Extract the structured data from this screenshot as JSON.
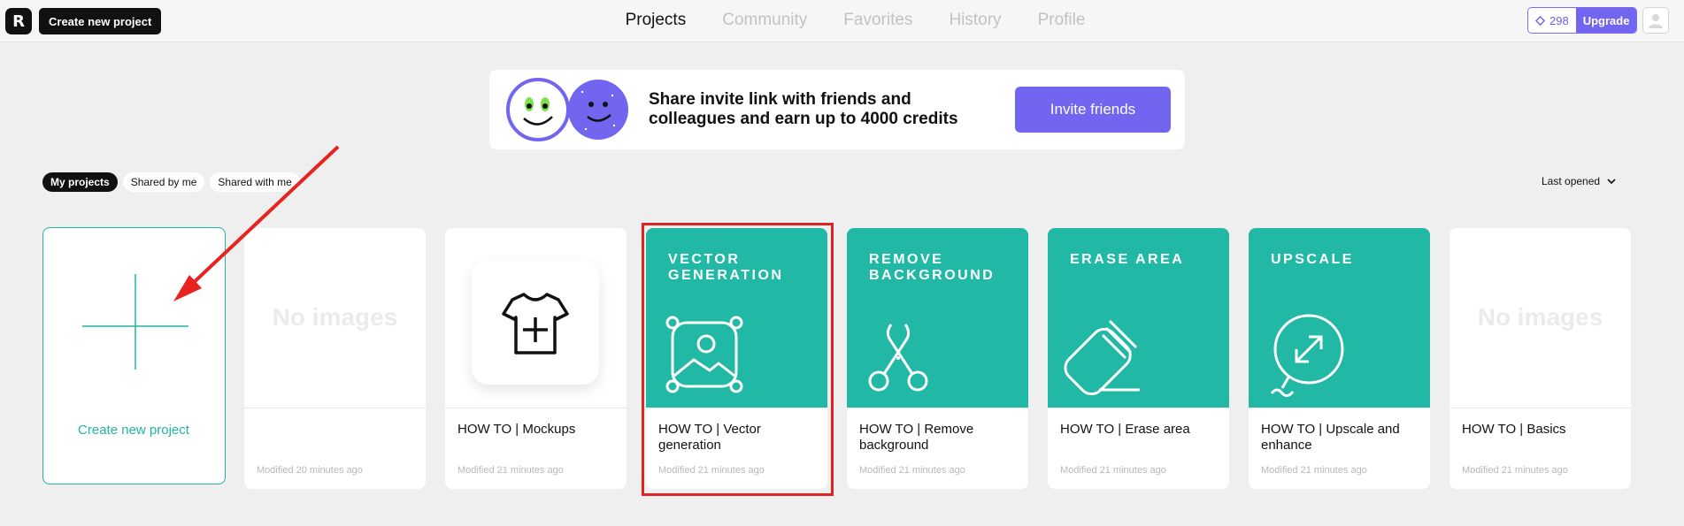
{
  "header": {
    "logo_text": "R",
    "create_button": "Create new project",
    "nav": [
      "Projects",
      "Community",
      "Favorites",
      "History",
      "Profile"
    ],
    "active_nav": "Projects",
    "credits": "298",
    "upgrade": "Upgrade"
  },
  "banner": {
    "text": "Share invite link with friends and colleagues and earn up to 4000 credits",
    "button": "Invite friends"
  },
  "filters": [
    "My projects",
    "Shared by me",
    "Shared with me"
  ],
  "sort_label": "Last opened",
  "new_project_label": "Create new project",
  "no_images_text": "No images",
  "cards": [
    {
      "title": "",
      "modified": "Modified 20 minutes ago",
      "thumb": "empty"
    },
    {
      "title": "HOW TO | Mockups",
      "modified": "Modified 21 minutes ago",
      "thumb": "mockup"
    },
    {
      "title": "HOW TO | Vector generation",
      "modified": "Modified 21 minutes ago",
      "thumb": "tool",
      "tool_label": "VECTOR GENERATION"
    },
    {
      "title": "HOW TO | Remove background",
      "modified": "Modified 21 minutes ago",
      "thumb": "tool",
      "tool_label": "REMOVE BACKGROUND"
    },
    {
      "title": "HOW TO | Erase area",
      "modified": "Modified 21 minutes ago",
      "thumb": "tool",
      "tool_label": "ERASE AREA"
    },
    {
      "title": "HOW TO | Upscale and enhance",
      "modified": "Modified 21 minutes ago",
      "thumb": "tool",
      "tool_label": "UPSCALE"
    },
    {
      "title": "HOW TO | Basics",
      "modified": "Modified 21 minutes ago",
      "thumb": "empty"
    }
  ],
  "colors": {
    "accent_purple": "#7265f0",
    "teal": "#21b8a6",
    "highlight_red": "#e02424"
  }
}
